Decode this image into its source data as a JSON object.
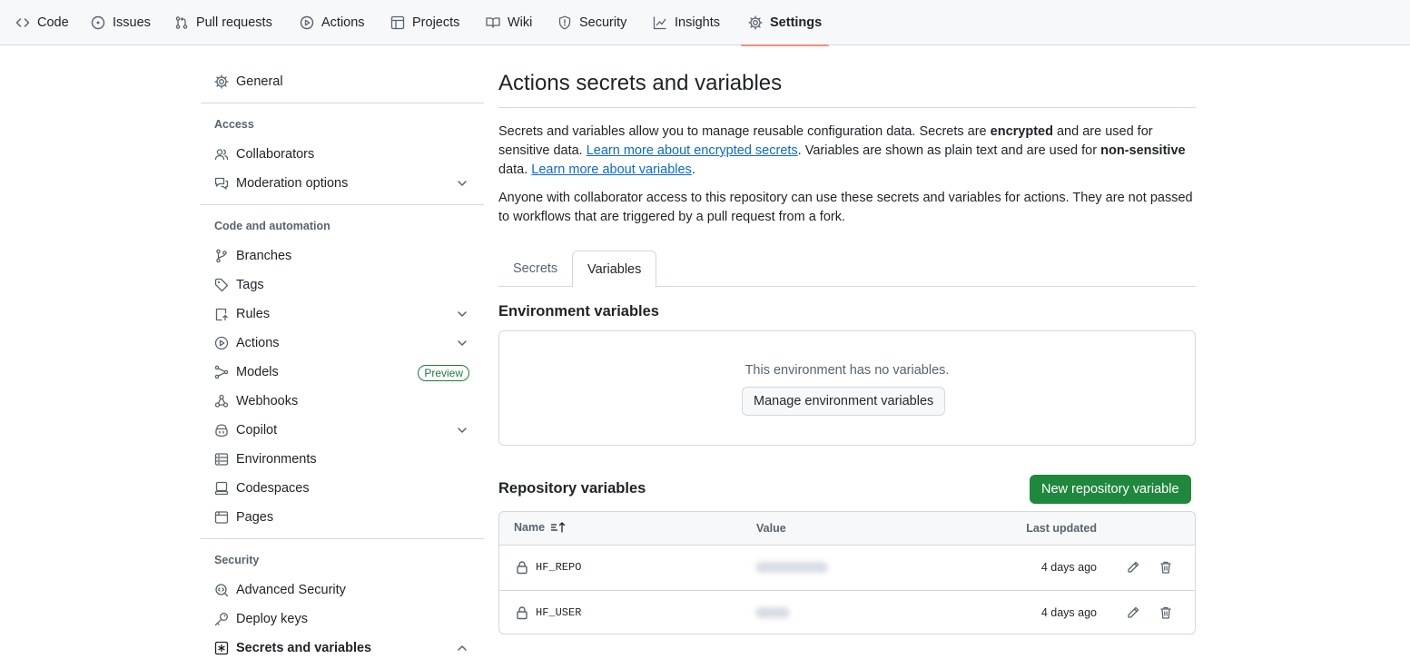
{
  "topnav": {
    "tabs": [
      {
        "label": "Code",
        "icon": "code-icon"
      },
      {
        "label": "Issues",
        "icon": "issue-icon"
      },
      {
        "label": "Pull requests",
        "icon": "pull-request-icon"
      },
      {
        "label": "Actions",
        "icon": "play-icon"
      },
      {
        "label": "Projects",
        "icon": "table-icon"
      },
      {
        "label": "Wiki",
        "icon": "book-icon"
      },
      {
        "label": "Security",
        "icon": "shield-icon"
      },
      {
        "label": "Insights",
        "icon": "graph-icon"
      },
      {
        "label": "Settings",
        "icon": "gear-icon",
        "active": true
      }
    ]
  },
  "sidebar": {
    "general": "General",
    "sections": {
      "access": "Access",
      "code_automation": "Code and automation",
      "security": "Security"
    },
    "items": {
      "collaborators": "Collaborators",
      "moderation": "Moderation options",
      "branches": "Branches",
      "tags": "Tags",
      "rules": "Rules",
      "actions": "Actions",
      "models": "Models",
      "models_badge": "Preview",
      "webhooks": "Webhooks",
      "copilot": "Copilot",
      "environments": "Environments",
      "codespaces": "Codespaces",
      "pages": "Pages",
      "advanced_security": "Advanced Security",
      "deploy_keys": "Deploy keys",
      "secrets_variables": "Secrets and variables"
    }
  },
  "main": {
    "title": "Actions secrets and variables",
    "intro": {
      "p1_a": "Secrets and variables allow you to manage reusable configuration data. Secrets are ",
      "p1_b": "encrypted",
      "p1_c": " and are used for sensitive data. ",
      "p1_link1": "Learn more about encrypted secrets",
      "p1_d": ". Variables are shown as plain text and are used for ",
      "p1_e": "non-sensitive",
      "p1_f": " data. ",
      "p1_link2": "Learn more about variables",
      "p1_g": ".",
      "p2": "Anyone with collaborator access to this repository can use these secrets and variables for actions. They are not passed to workflows that are triggered by a pull request from a fork."
    },
    "tabs": {
      "secrets": "Secrets",
      "variables": "Variables"
    },
    "env": {
      "heading": "Environment variables",
      "empty": "This environment has no variables.",
      "manage_button": "Manage environment variables"
    },
    "repo": {
      "heading": "Repository variables",
      "new_button": "New repository variable",
      "columns": {
        "name": "Name",
        "value": "Value",
        "updated": "Last updated"
      },
      "rows": [
        {
          "name": "HF_REPO",
          "updated": "4 days ago"
        },
        {
          "name": "HF_USER",
          "updated": "4 days ago"
        }
      ]
    }
  },
  "colors": {
    "accent_underline": "#fd8c73",
    "link": "#0969da",
    "primary_button": "#1f883d",
    "preview_badge": "#1a7f37"
  }
}
